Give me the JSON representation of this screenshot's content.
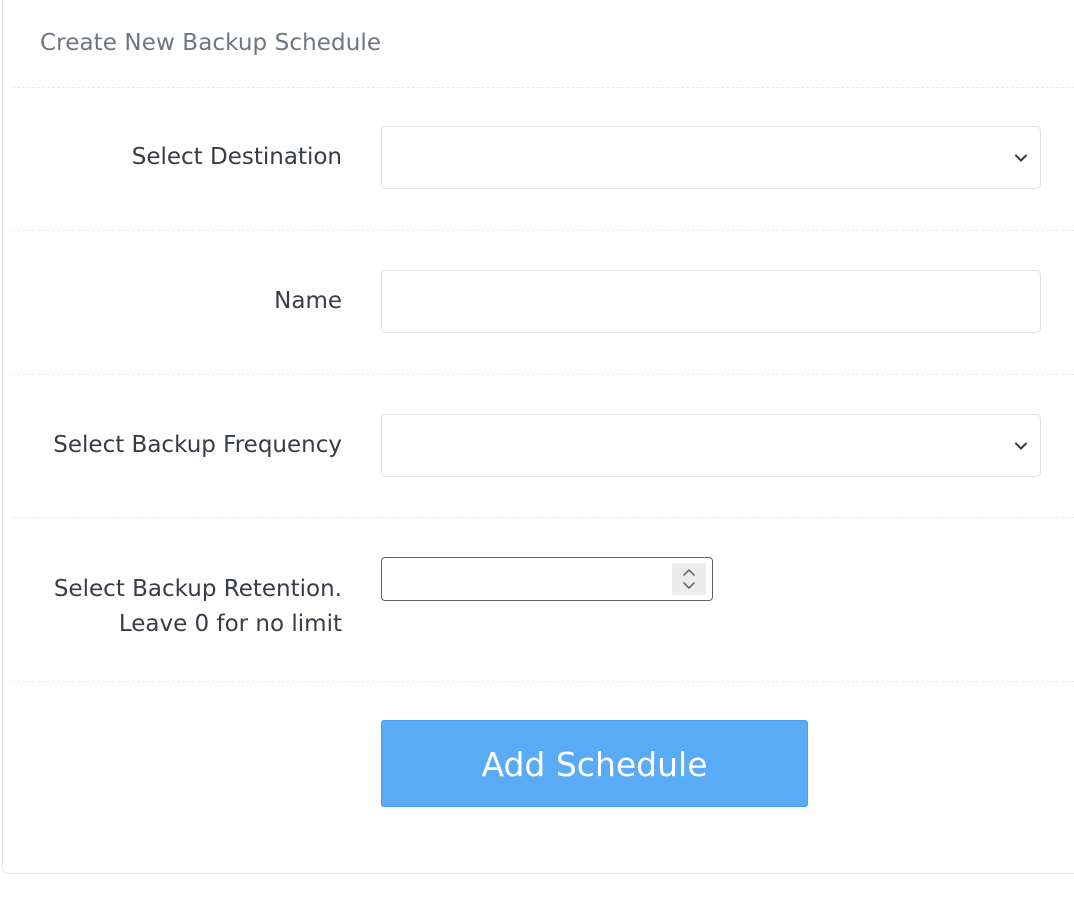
{
  "form": {
    "title": "Create New Backup Schedule",
    "destination_label": "Select Destination",
    "destination_value": "",
    "name_label": "Name",
    "name_value": "",
    "frequency_label": "Select Backup Frequency",
    "frequency_value": "",
    "retention_label_line1": "Select Backup Retention.",
    "retention_label_line2": "Leave 0 for no limit",
    "retention_value": "",
    "submit_label": "Add Schedule"
  },
  "icons": {
    "select_arrow": "chevron-down-icon",
    "number_spinner": "spinner-updown-icon"
  },
  "colors": {
    "button_bg": "#5aabf5",
    "button_text": "#ffffff",
    "label_text": "#373c45",
    "title_text": "#6f7682"
  }
}
